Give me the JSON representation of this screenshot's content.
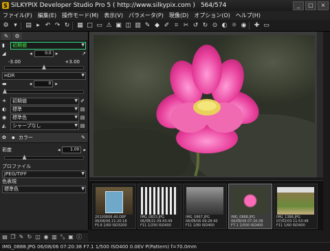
{
  "window": {
    "title": "SILKYPIX Developer Studio Pro 5 ( http://www.silkypix.com )",
    "counter": "564/574",
    "logo_letter": "S"
  },
  "menu": [
    "ファイル(F)",
    "編集(E)",
    "操作モード(M)",
    "表示(V)",
    "パラメータ(P)",
    "現像(D)",
    "オプション(O)",
    "ヘルプ(H)"
  ],
  "left_panel": {
    "preset": "初期値",
    "exposure_value": "0.0",
    "exposure_min": "-3.00",
    "exposure_max": "+3.00",
    "exposure_level": 0.5,
    "hdr_label": "HDR",
    "hdr_value": "0",
    "hdr_level": 0.0,
    "dropdowns": [
      "初期値",
      "標準",
      "標準色",
      "シャープなし"
    ],
    "color_section": "カラー",
    "saturation_label": "彩度",
    "saturation_value": "1.00",
    "saturation_level": 0.25,
    "profile_label": "プロファイル",
    "profile_value": "JPEG/TIFF",
    "color_rep_label": "色表現",
    "color_rep_value": "標準色"
  },
  "thumbnails": [
    {
      "caption": "20100806.40.ORF\n06/08/06 21:20:18\nF5.6 1/60 ISO3200",
      "icon": "camera-box"
    },
    {
      "caption": "IMG_0823.JPG\n06/08/21 09:43:49\nF11 1/250 ISO400",
      "icon": "bw-scene"
    },
    {
      "caption": "IMG_0867.JPG\n06/08/06 09:28:40\nF11 1/80 ISO400",
      "icon": "street"
    },
    {
      "caption": "IMG_0888.JPG\n06/08/06 07:20:38\nF7.1 1/500 ISO400",
      "icon": "lotus"
    },
    {
      "caption": "IMG_1386.JPG\n07/02/03 11:53:48\nF11 1/60 ISO400",
      "icon": "flowers"
    }
  ],
  "status": "IMG_0888.JPG 06/08/06 07:20:38 F7.1 1/500 ISO400  0.0EV P(Pattern) f=70.0mm"
}
